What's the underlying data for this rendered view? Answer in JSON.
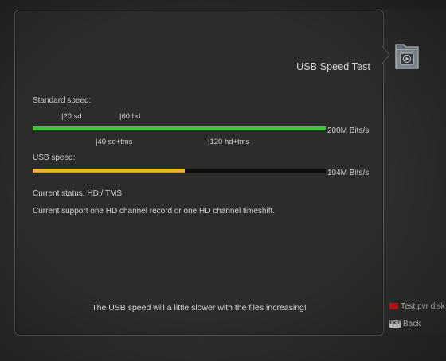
{
  "panel": {
    "title": "USB Speed Test"
  },
  "standard": {
    "label": "Standard speed:",
    "ticks_top": [
      "|20 sd",
      "|60 hd"
    ],
    "ticks_bottom": [
      "|40 sd+tms",
      "|120 hd+tms"
    ],
    "value_label": "200M Bits/s",
    "fill_fraction": 1.0,
    "color": "#3fc33b"
  },
  "usb": {
    "label": "USB speed:",
    "value_label": "104M Bits/s",
    "fill_fraction": 0.52,
    "color": "#f0b52e"
  },
  "status": {
    "current_status": "Current status: HD / TMS",
    "current_support": "Current support one HD channel record or one HD channel timeshift."
  },
  "note": "The USB speed will a little slower with the files increasing!",
  "legend": {
    "test_pvr_label": "Test pvr disk s",
    "exit_key_label": "EXIT",
    "back_label": "Back"
  },
  "icons": {
    "folder": "folder-icon",
    "pointer": "pointer-arrow-icon",
    "red_key": "red-button-icon",
    "exit_key": "exit-key-icon"
  }
}
